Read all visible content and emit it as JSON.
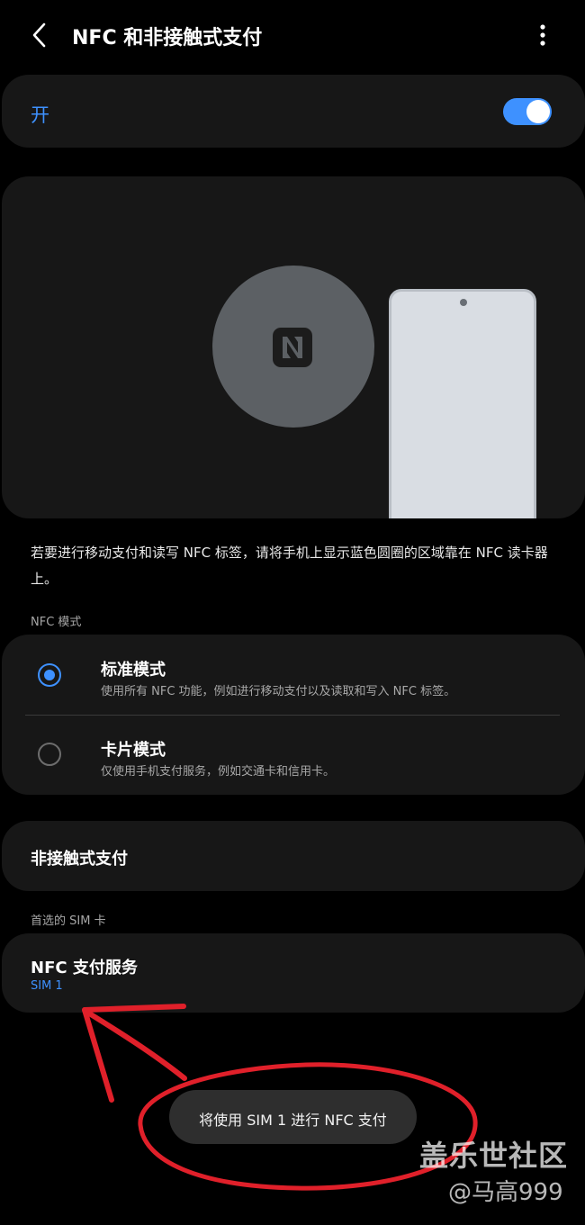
{
  "header": {
    "title": "NFC 和非接触式支付"
  },
  "master_switch": {
    "label": "开",
    "state": "on"
  },
  "description": "若要进行移动支付和读写 NFC 标签，请将手机上显示蓝色圆圈的区域靠在 NFC 读卡器上。",
  "nfc_mode": {
    "section_label": "NFC 模式",
    "options": [
      {
        "title": "标准模式",
        "subtitle": "使用所有 NFC 功能，例如进行移动支付以及读取和写入 NFC 标签。",
        "selected": true
      },
      {
        "title": "卡片模式",
        "subtitle": "仅使用手机支付服务，例如交通卡和信用卡。",
        "selected": false
      }
    ]
  },
  "contactless_payment": {
    "label": "非接触式支付"
  },
  "preferred_sim": {
    "section_label": "首选的 SIM 卡",
    "item_title": "NFC 支付服务",
    "item_value": "SIM 1"
  },
  "toast": {
    "text": "将使用 SIM 1 进行 NFC 支付"
  },
  "watermark": {
    "site": "盖乐世社区",
    "author": "@马高999"
  },
  "colors": {
    "accent": "#3e91ff",
    "card": "#171717",
    "background": "#000000",
    "annotation": "#e0202a"
  },
  "icons": {
    "back": "chevron-left-icon",
    "more": "more-vertical-icon",
    "nfc": "nfc-icon"
  }
}
